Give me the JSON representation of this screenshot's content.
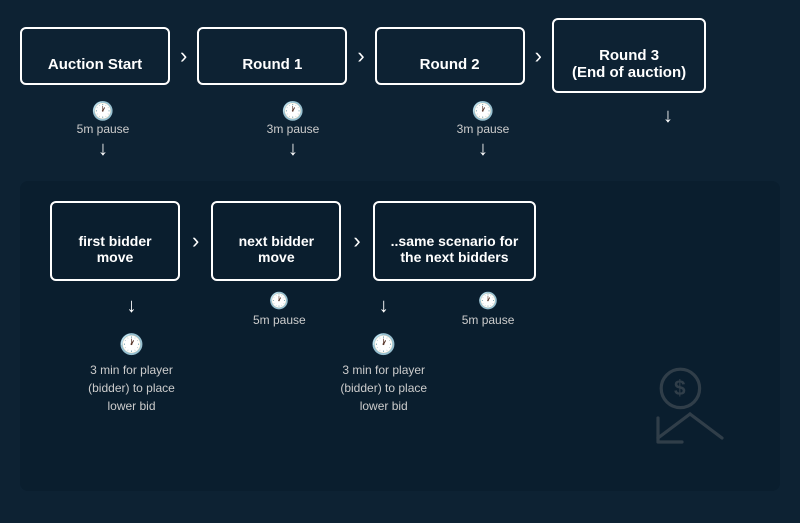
{
  "top": {
    "steps": [
      {
        "label": "Auction Start",
        "id": "auction-start"
      },
      {
        "label": "Round 1",
        "id": "round-1"
      },
      {
        "label": "Round 2",
        "id": "round-2"
      },
      {
        "label": "Round 3\n(End of auction)",
        "id": "round-3"
      }
    ],
    "pauses": [
      {
        "label": "5m pause",
        "id": "pause-5m-1"
      },
      {
        "label": "3m pause",
        "id": "pause-3m-1"
      },
      {
        "label": "3m pause",
        "id": "pause-3m-2"
      }
    ]
  },
  "bottom": {
    "steps": [
      {
        "label": "first bidder\nmove",
        "id": "first-bidder"
      },
      {
        "label": "next bidder\nmove",
        "id": "next-bidder"
      },
      {
        "label": "..same scenario for\nthe next bidders",
        "id": "same-scenario"
      }
    ],
    "detail_left": {
      "down_arrow": "↓",
      "pause_label": "5m pause",
      "clock_label": "",
      "desc": "3 min for player\n(bidder) to place\nlower bid"
    },
    "detail_right": {
      "down_arrow": "↓",
      "pause_label": "5m pause",
      "clock_label": "",
      "desc": "3 min for player\n(bidder) to place\nlower bid"
    }
  }
}
